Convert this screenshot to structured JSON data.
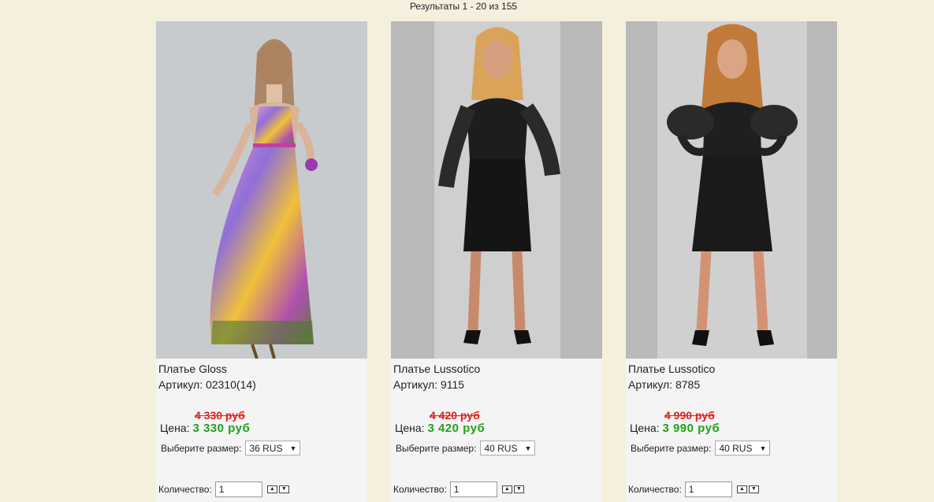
{
  "results": {
    "text": "Результаты 1 - 20 из 155"
  },
  "labels": {
    "price": "Цена:",
    "size": "Выберите размер:",
    "qty": "Количество:",
    "sku": "Артикул:"
  },
  "products": [
    {
      "name": "Платье Gloss",
      "sku": "Артикул: 02310(14)",
      "old_price": "4 330 руб",
      "price": "3 330 руб",
      "size": "36 RUS",
      "qty": "1",
      "image": "model-in-floral-strapless-maxi-dress"
    },
    {
      "name": "Платье Lussotico",
      "sku": "Артикул: 9115",
      "old_price": "4 420 руб",
      "price": "3 420 руб",
      "size": "40 RUS",
      "qty": "1",
      "image": "model-in-black-dress-with-lace-sleeves"
    },
    {
      "name": "Платье Lussotico",
      "sku": "Артикул: 8785",
      "old_price": "4 990 руб",
      "price": "3 990 руб",
      "size": "40 RUS",
      "qty": "1",
      "image": "model-in-black-dress-with-puff-sleeves"
    }
  ],
  "colors": {
    "background": "#f5efdd",
    "card": "#f4f4f4",
    "old_price": "#e0201c",
    "price": "#22a11b"
  },
  "icons": {
    "up": "arrow-up-icon",
    "down": "arrow-down-icon",
    "caret": "chevron-down-icon"
  }
}
